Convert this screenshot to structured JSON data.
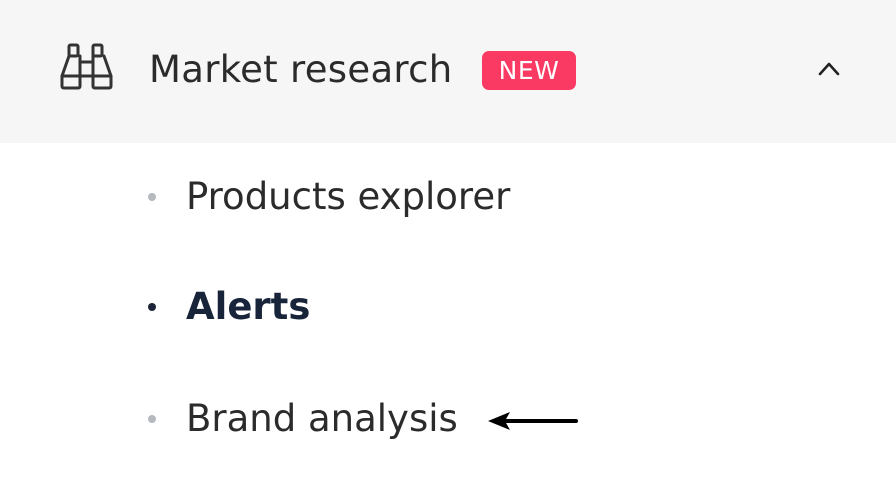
{
  "section": {
    "title": "Market research",
    "badge": "NEW",
    "icon": "binoculars-icon",
    "toggle_icon": "chevron-up-icon",
    "expanded": true
  },
  "submenu": {
    "items": [
      {
        "label": "Products explorer",
        "active": false
      },
      {
        "label": "Alerts",
        "active": true
      },
      {
        "label": "Brand analysis",
        "active": false
      }
    ]
  },
  "annotation": {
    "icon": "arrow-left-icon",
    "points_to": "Brand analysis"
  },
  "colors": {
    "header_bg": "#f6f6f6",
    "badge_bg": "#fb3a63",
    "text": "#2b2b2b",
    "active_text": "#18243a",
    "bullet_inactive": "#b5b9c0",
    "bullet_active": "#1b2536"
  }
}
